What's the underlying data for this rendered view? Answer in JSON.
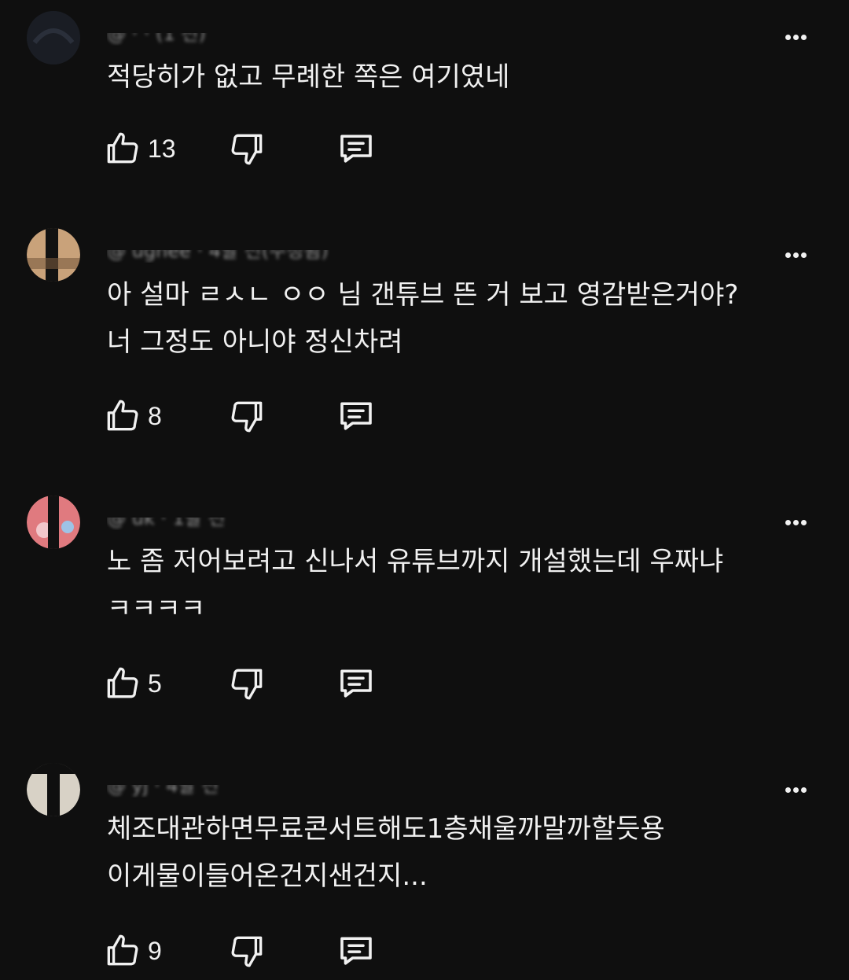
{
  "comments": [
    {
      "header": "@ ·  · (1 전)",
      "text": "적당히가 없고 무례한 쪽은 여기였네",
      "likes": "13",
      "avatar_color": "#20242c"
    },
    {
      "header": "@ ughee · 4달 전(수정됨)",
      "text": "아 설마 ㄹㅅㄴ ㅇㅇ 님 갠튜브 뜬 거 보고 영감받은거야?\n너 그정도 아니야 정신차려",
      "likes": "8",
      "avatar_color": "#c9a27a"
    },
    {
      "header": "@ uk · 1달 전",
      "text": "노 좀 저어보려고 신나서 유튜브까지 개설했는데 우짜냐\nㅋㅋㅋㅋ",
      "likes": "5",
      "avatar_color": "#e07a7f"
    },
    {
      "header": "@ yj · 4달 전",
      "text": "체조대관하면무료콘서트해도1층채울까말까할듯용\n이게물이들어온건지샌건지...",
      "likes": "9",
      "avatar_color": "#d8d2c6"
    }
  ],
  "icons": {
    "like": "thumbs-up-icon",
    "dislike": "thumbs-down-icon",
    "reply": "reply-comment-icon",
    "more": "more-options-icon"
  }
}
